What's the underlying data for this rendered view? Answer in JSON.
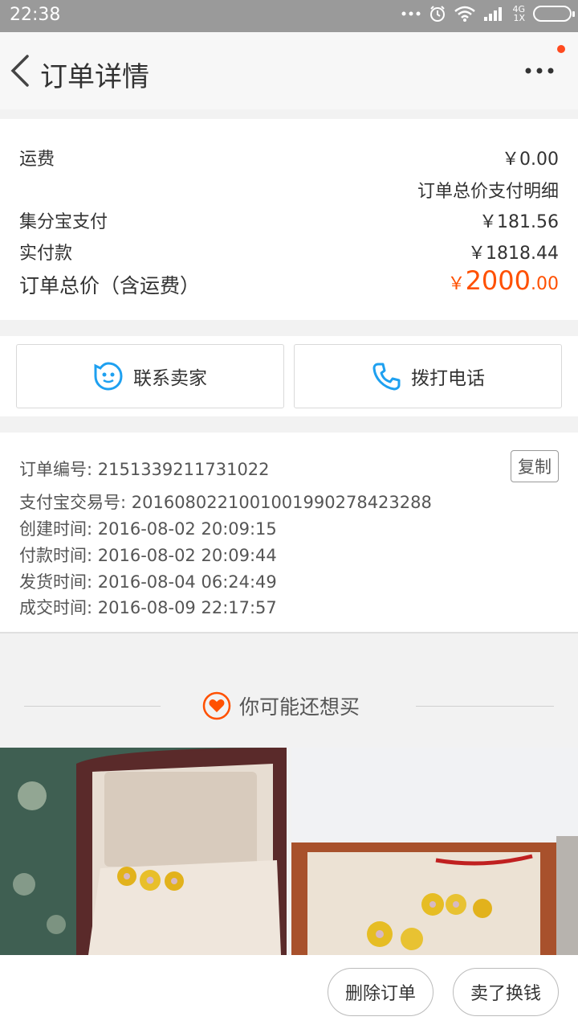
{
  "status_bar": {
    "time": "22:38",
    "network_top": "4G",
    "network_bottom": "1X"
  },
  "nav": {
    "title": "订单详情"
  },
  "fees": {
    "shipping_label": "运费",
    "shipping_value": "￥0.00",
    "detail_link": "订单总价支付明细",
    "points_label": "集分宝支付",
    "points_value": "￥181.56",
    "paid_label": "实付款",
    "paid_value": "￥1818.44",
    "total_label": "订单总价（含运费）",
    "total_currency": "￥",
    "total_int": "2000",
    "total_dec": ".00"
  },
  "actions": {
    "contact_seller": "联系卖家",
    "call_phone": "拨打电话"
  },
  "order_info": {
    "order_no": "订单编号: 2151339211731022",
    "copy_label": "复制",
    "alipay_no": "支付宝交易号: 2016080221001001990278423288",
    "created": "创建时间: 2016-08-02 20:09:15",
    "paid": "付款时间: 2016-08-02 20:09:44",
    "shipped": "发货时间: 2016-08-04 06:24:49",
    "completed": "成交时间: 2016-08-09 22:17:57"
  },
  "recommend": {
    "title": "你可能还想买"
  },
  "bottom": {
    "delete_order": "删除订单",
    "resell": "卖了换钱"
  },
  "colors": {
    "accent": "#ff5000",
    "link_blue": "#1ea0f0"
  }
}
